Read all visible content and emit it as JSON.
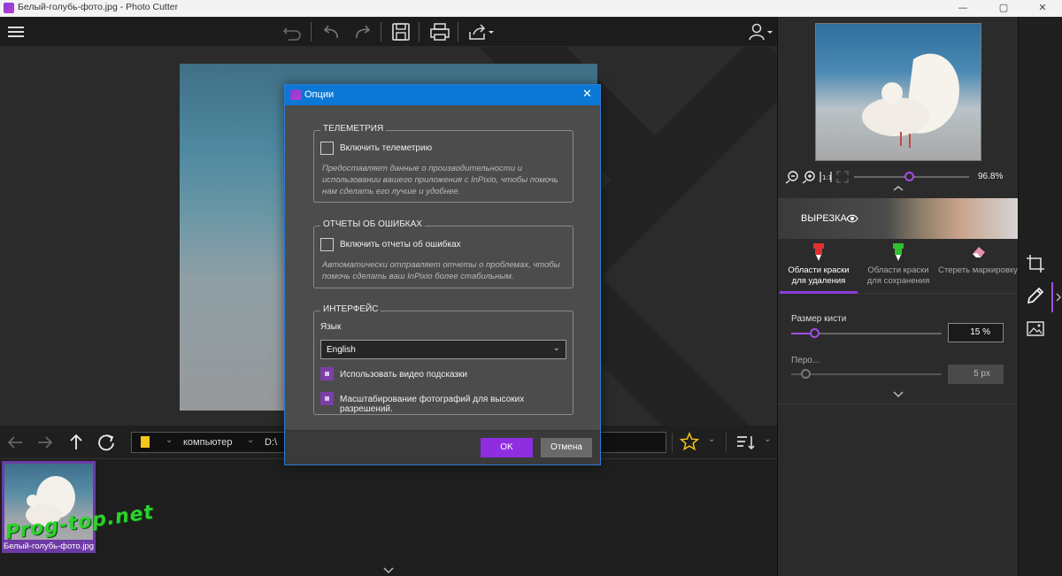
{
  "window": {
    "title": "Белый-голубь-фото.jpg - Photo Cutter",
    "min": "—",
    "max": "▢",
    "close": "✕"
  },
  "navbar": {
    "path_computer": "компьютер",
    "path_drive": "D:\\"
  },
  "thumbnail": {
    "caption": "Белый-голубь-фото.jpg"
  },
  "watermark": "Prog-top.net",
  "right_panel": {
    "zoom_value": "96.8%",
    "zoom_level": 0.72,
    "cut_label": "ВЫРЕЗКА",
    "tools": [
      {
        "label_l1": "Области краски",
        "label_l2": "для удаления",
        "color": "#e03030"
      },
      {
        "label_l1": "Области краски",
        "label_l2": "для сохранения",
        "color": "#30c030"
      },
      {
        "label_l1": "Стереть маркировку",
        "label_l2": "",
        "color": "#e88fb0"
      }
    ],
    "brush_size_label": "Размер кисти",
    "brush_size_value": "15 %",
    "brush_size_level": 0.15,
    "feather_label": "Перо...",
    "feather_value": "5 px",
    "feather_level": 0.0
  },
  "dialog": {
    "title": "Опции",
    "telemetry": {
      "group_label": "ТЕЛЕМЕТРИЯ",
      "checkbox_label": "Включить телеметрию",
      "checked": false,
      "desc_l1": "Предоставляет данные о производительности и",
      "desc_l2": "использовании вашего приложения с InPixio, чтобы помочь",
      "desc_l3": "нам сделать его лучше и удобнее."
    },
    "errors": {
      "group_label": "ОТЧЕТЫ ОБ ОШИБКАХ",
      "checkbox_label": "Включить отчеты об ошибках",
      "checked": false,
      "desc_l1": "Автоматически отправляет отчеты о проблемах, чтобы",
      "desc_l2": "помочь сделать ваш InPixio более стабильным."
    },
    "interface": {
      "group_label": "ИНТЕРФЕЙС",
      "language_label": "Язык",
      "language_value": "English",
      "video_hints_label": "Использовать видео подсказки",
      "video_hints_checked": true,
      "hidpi_label": "Масштабирование фотографий для высоких разрешений.",
      "hidpi_checked": true
    },
    "ok_label": "OK",
    "cancel_label": "Отмена"
  },
  "colors": {
    "accent": "#8f2de0",
    "dialog_title": "#0a78d4",
    "star": "#f5c518"
  }
}
